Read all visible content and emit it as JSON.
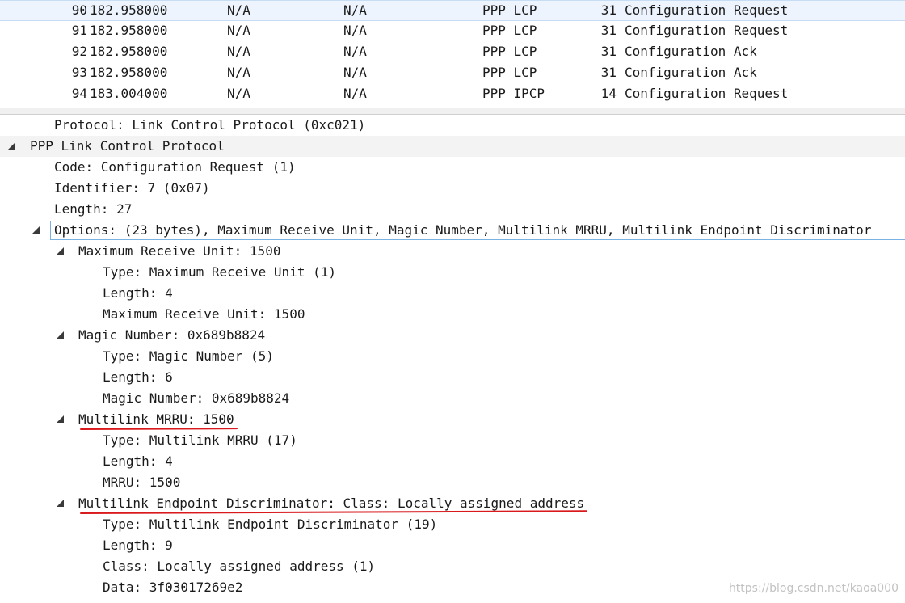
{
  "packet_list": {
    "rows": [
      {
        "no": "90",
        "time": "182.958000",
        "source": "N/A",
        "destination": "N/A",
        "protocol": "PPP LCP",
        "length": "31",
        "info": "Configuration Request",
        "selected": true
      },
      {
        "no": "91",
        "time": "182.958000",
        "source": "N/A",
        "destination": "N/A",
        "protocol": "PPP LCP",
        "length": "31",
        "info": "Configuration Request"
      },
      {
        "no": "92",
        "time": "182.958000",
        "source": "N/A",
        "destination": "N/A",
        "protocol": "PPP LCP",
        "length": "31",
        "info": "Configuration Ack"
      },
      {
        "no": "93",
        "time": "182.958000",
        "source": "N/A",
        "destination": "N/A",
        "protocol": "PPP LCP",
        "length": "31",
        "info": "Configuration Ack"
      },
      {
        "no": "94",
        "time": "183.004000",
        "source": "N/A",
        "destination": "N/A",
        "protocol": "PPP IPCP",
        "length": "14",
        "info": "Configuration Request"
      }
    ]
  },
  "detail_tree": {
    "rows": [
      {
        "text": "Protocol: Link Control Protocol (0xc021)",
        "level": 2
      },
      {
        "text": "PPP Link Control Protocol",
        "level": 1,
        "expanded": true,
        "highlight": true
      },
      {
        "text": "Code: Configuration Request (1)",
        "level": 2
      },
      {
        "text": "Identifier: 7 (0x07)",
        "level": 2
      },
      {
        "text": "Length: 27",
        "level": 2
      },
      {
        "text": "Options: (23 bytes), Maximum Receive Unit, Magic Number, Multilink MRRU, Multilink Endpoint Discriminator",
        "level": 2,
        "expanded": true,
        "selected": true
      },
      {
        "text": "Maximum Receive Unit: 1500",
        "level": 3,
        "expanded": true
      },
      {
        "text": "Type: Maximum Receive Unit (1)",
        "level": 4
      },
      {
        "text": "Length: 4",
        "level": 4
      },
      {
        "text": "Maximum Receive Unit: 1500",
        "level": 4
      },
      {
        "text": "Magic Number: 0x689b8824",
        "level": 3,
        "expanded": true
      },
      {
        "text": "Type: Magic Number (5)",
        "level": 4
      },
      {
        "text": "Length: 6",
        "level": 4
      },
      {
        "text": "Magic Number: 0x689b8824",
        "level": 4
      },
      {
        "text": "Multilink MRRU: 1500",
        "level": 3,
        "expanded": true,
        "underlined": true
      },
      {
        "text": "Type: Multilink MRRU (17)",
        "level": 4
      },
      {
        "text": "Length: 4",
        "level": 4
      },
      {
        "text": "MRRU: 1500",
        "level": 4
      },
      {
        "text": "Multilink Endpoint Discriminator: Class: Locally assigned address",
        "level": 3,
        "expanded": true,
        "underlined": true
      },
      {
        "text": "Type: Multilink Endpoint Discriminator (19)",
        "level": 4
      },
      {
        "text": "Length: 9",
        "level": 4
      },
      {
        "text": "Class: Locally assigned address (1)",
        "level": 4
      },
      {
        "text": "Data: 3f03017269e2",
        "level": 4
      }
    ]
  },
  "icons": {
    "tree_expander": "expanded-triangle-icon"
  },
  "colors": {
    "annotation_underline": "#d9191c",
    "selection_border": "#7ab2e4",
    "selected_row_bg": "#edf4fd"
  },
  "watermark": "https://blog.csdn.net/kaoa000"
}
